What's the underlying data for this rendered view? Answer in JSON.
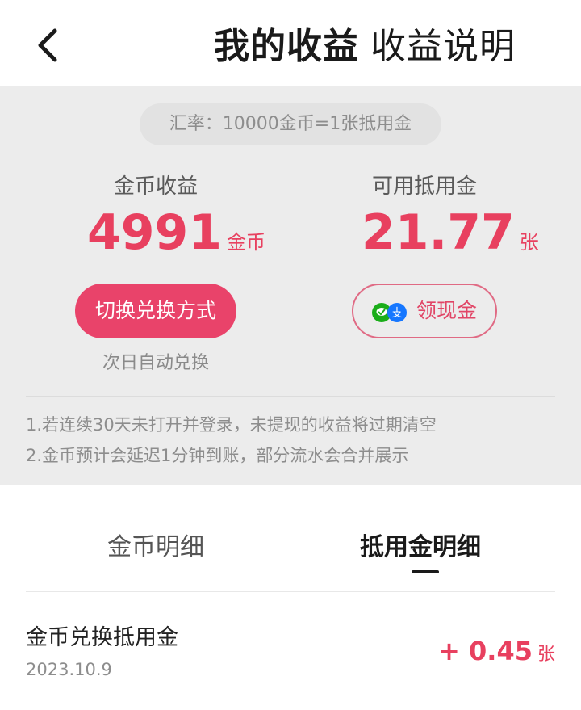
{
  "header": {
    "title": "我的收益",
    "explain_label": "收益说明",
    "back_icon": "chevron-left-icon"
  },
  "summary": {
    "rate": "汇率：10000金币=1张抵用金",
    "coin": {
      "label": "金币收益",
      "value": "4991",
      "unit": "金币"
    },
    "voucher": {
      "label": "可用抵用金",
      "value": "21.77",
      "unit": "张"
    },
    "switch_button": "切换兑换方式",
    "auto_note": "次日自动兑换",
    "cash_button": "领现金",
    "cash_icons": [
      "wechat-pay-icon",
      "alipay-icon"
    ]
  },
  "notices": [
    "1.若连续30天未打开并登录，未提现的收益将过期清空",
    "2.金币预计会延迟1分钟到账，部分流水会合并展示"
  ],
  "tabs": [
    {
      "label": "金币明细",
      "active": false
    },
    {
      "label": "抵用金明细",
      "active": true
    }
  ],
  "records": [
    {
      "title": "金币兑换抵用金",
      "date": "2023.10.9",
      "amount": "+ 0.45",
      "unit": "张"
    }
  ],
  "colors": {
    "accent": "#e8405f",
    "button": "#e9436a",
    "background_gray": "#ececec",
    "wechat": "#1aad19",
    "alipay": "#1677ff"
  }
}
